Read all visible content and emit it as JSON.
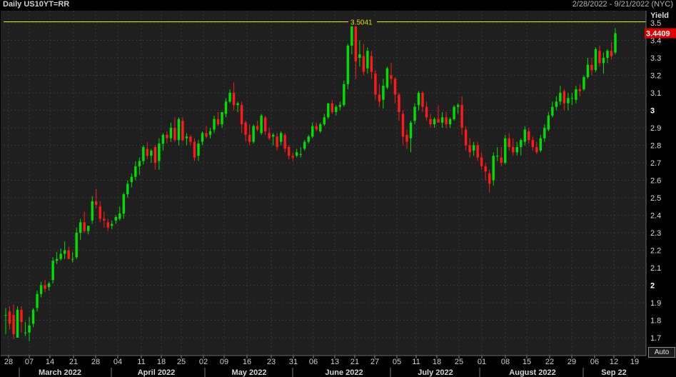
{
  "header": {
    "title": "Daily US10YT=RR",
    "date_range": "2/28/2022 - 9/21/2022 (NYC)",
    "y_axis_label": "Yield",
    "auto_button": "Auto"
  },
  "colors": {
    "up": "#00e000",
    "down": "#ff1a1a",
    "highlight": "#e8e800",
    "last_price_bg": "#e00000",
    "background": "#1e1f1e",
    "grid": "#3a3a3a"
  },
  "chart_data": {
    "type": "candlestick",
    "title": "Daily US10YT=RR",
    "ylabel": "Yield",
    "ylim": [
      1.64,
      3.55
    ],
    "y_ticks": [
      "1.7",
      "1.8",
      "1.9",
      "2",
      "2.1",
      "2.2",
      "2.3",
      "2.4",
      "2.5",
      "2.6",
      "2.7",
      "2.8",
      "2.9",
      "3",
      "3.1",
      "3.2",
      "3.3",
      "3.4",
      "3.5"
    ],
    "y_bold_ticks": [
      "2",
      "3"
    ],
    "x_day_ticks": [
      "28",
      "07",
      "14",
      "21",
      "28",
      "04",
      "11",
      "18",
      "25",
      "02",
      "09",
      "16",
      "23",
      "31",
      "06",
      "13",
      "21",
      "27",
      "05",
      "11",
      "18",
      "25",
      "01",
      "08",
      "15",
      "22",
      "29",
      "06",
      "12",
      "19"
    ],
    "x_month_labels": [
      "March 2022",
      "April 2022",
      "May 2022",
      "June 2022",
      "July 2022",
      "August 2022",
      "Sep 22"
    ],
    "highlight": {
      "label": "3.5041",
      "value": 3.5041
    },
    "last_price": {
      "label": "3.4409",
      "value": 3.4409
    },
    "grid": true,
    "candles": [
      {
        "o": 1.83,
        "h": 1.87,
        "l": 1.72,
        "c": 1.83
      },
      {
        "o": 1.85,
        "h": 1.88,
        "l": 1.75,
        "c": 1.78
      },
      {
        "o": 1.83,
        "h": 1.89,
        "l": 1.69,
        "c": 1.72
      },
      {
        "o": 1.7,
        "h": 1.88,
        "l": 1.7,
        "c": 1.86
      },
      {
        "o": 1.86,
        "h": 1.88,
        "l": 1.73,
        "c": 1.79
      },
      {
        "o": 1.73,
        "h": 1.79,
        "l": 1.71,
        "c": 1.73
      },
      {
        "o": 1.73,
        "h": 1.82,
        "l": 1.68,
        "c": 1.77
      },
      {
        "o": 1.78,
        "h": 1.87,
        "l": 1.76,
        "c": 1.86
      },
      {
        "o": 1.87,
        "h": 1.97,
        "l": 1.85,
        "c": 1.95
      },
      {
        "o": 1.95,
        "h": 2.02,
        "l": 1.93,
        "c": 2.0
      },
      {
        "o": 2.0,
        "h": 2.03,
        "l": 1.96,
        "c": 1.98
      },
      {
        "o": 1.99,
        "h": 2.02,
        "l": 1.97,
        "c": 2.01
      },
      {
        "o": 2.03,
        "h": 2.16,
        "l": 2.01,
        "c": 2.14
      },
      {
        "o": 2.14,
        "h": 2.19,
        "l": 2.12,
        "c": 2.15
      },
      {
        "o": 2.15,
        "h": 2.21,
        "l": 2.14,
        "c": 2.18
      },
      {
        "o": 2.18,
        "h": 2.25,
        "l": 2.15,
        "c": 2.2
      },
      {
        "o": 2.2,
        "h": 2.22,
        "l": 2.15,
        "c": 2.15
      },
      {
        "o": 2.15,
        "h": 2.19,
        "l": 2.13,
        "c": 2.15
      },
      {
        "o": 2.16,
        "h": 2.33,
        "l": 2.15,
        "c": 2.3
      },
      {
        "o": 2.3,
        "h": 2.38,
        "l": 2.26,
        "c": 2.36
      },
      {
        "o": 2.36,
        "h": 2.42,
        "l": 2.3,
        "c": 2.31
      },
      {
        "o": 2.31,
        "h": 2.34,
        "l": 2.29,
        "c": 2.34
      },
      {
        "o": 2.37,
        "h": 2.51,
        "l": 2.35,
        "c": 2.48
      },
      {
        "o": 2.48,
        "h": 2.55,
        "l": 2.44,
        "c": 2.46
      },
      {
        "o": 2.45,
        "h": 2.48,
        "l": 2.36,
        "c": 2.38
      },
      {
        "o": 2.38,
        "h": 2.42,
        "l": 2.33,
        "c": 2.37
      },
      {
        "o": 2.36,
        "h": 2.38,
        "l": 2.31,
        "c": 2.33
      },
      {
        "o": 2.34,
        "h": 2.37,
        "l": 2.32,
        "c": 2.35
      },
      {
        "o": 2.37,
        "h": 2.4,
        "l": 2.35,
        "c": 2.39
      },
      {
        "o": 2.38,
        "h": 2.45,
        "l": 2.37,
        "c": 2.41
      },
      {
        "o": 2.41,
        "h": 2.53,
        "l": 2.38,
        "c": 2.52
      },
      {
        "o": 2.52,
        "h": 2.6,
        "l": 2.5,
        "c": 2.58
      },
      {
        "o": 2.59,
        "h": 2.64,
        "l": 2.56,
        "c": 2.62
      },
      {
        "o": 2.62,
        "h": 2.71,
        "l": 2.6,
        "c": 2.68
      },
      {
        "o": 2.68,
        "h": 2.73,
        "l": 2.63,
        "c": 2.71
      },
      {
        "o": 2.71,
        "h": 2.8,
        "l": 2.69,
        "c": 2.79
      },
      {
        "o": 2.78,
        "h": 2.82,
        "l": 2.72,
        "c": 2.74
      },
      {
        "o": 2.74,
        "h": 2.78,
        "l": 2.7,
        "c": 2.77
      },
      {
        "o": 2.79,
        "h": 2.8,
        "l": 2.66,
        "c": 2.7
      },
      {
        "o": 2.71,
        "h": 2.84,
        "l": 2.66,
        "c": 2.81
      },
      {
        "o": 2.81,
        "h": 2.87,
        "l": 2.77,
        "c": 2.86
      },
      {
        "o": 2.86,
        "h": 2.88,
        "l": 2.81,
        "c": 2.84
      },
      {
        "o": 2.84,
        "h": 2.93,
        "l": 2.82,
        "c": 2.9
      },
      {
        "o": 2.9,
        "h": 2.96,
        "l": 2.82,
        "c": 2.83
      },
      {
        "o": 2.83,
        "h": 2.96,
        "l": 2.8,
        "c": 2.95
      },
      {
        "o": 2.94,
        "h": 2.96,
        "l": 2.82,
        "c": 2.83
      },
      {
        "o": 2.84,
        "h": 2.87,
        "l": 2.8,
        "c": 2.85
      },
      {
        "o": 2.85,
        "h": 2.86,
        "l": 2.8,
        "c": 2.82
      },
      {
        "o": 2.82,
        "h": 2.84,
        "l": 2.71,
        "c": 2.73
      },
      {
        "o": 2.74,
        "h": 2.83,
        "l": 2.71,
        "c": 2.81
      },
      {
        "o": 2.82,
        "h": 2.88,
        "l": 2.8,
        "c": 2.87
      },
      {
        "o": 2.87,
        "h": 2.91,
        "l": 2.84,
        "c": 2.85
      },
      {
        "o": 2.86,
        "h": 2.9,
        "l": 2.84,
        "c": 2.88
      },
      {
        "o": 2.89,
        "h": 2.97,
        "l": 2.87,
        "c": 2.95
      },
      {
        "o": 2.95,
        "h": 2.99,
        "l": 2.91,
        "c": 2.92
      },
      {
        "o": 2.92,
        "h": 2.99,
        "l": 2.9,
        "c": 2.99
      },
      {
        "o": 2.98,
        "h": 3.07,
        "l": 2.96,
        "c": 3.05
      },
      {
        "o": 3.05,
        "h": 3.12,
        "l": 3.04,
        "c": 3.1
      },
      {
        "o": 3.1,
        "h": 3.16,
        "l": 3.0,
        "c": 3.03
      },
      {
        "o": 3.03,
        "h": 3.05,
        "l": 2.99,
        "c": 3.04
      },
      {
        "o": 3.03,
        "h": 3.05,
        "l": 2.87,
        "c": 2.92
      },
      {
        "o": 2.93,
        "h": 2.94,
        "l": 2.82,
        "c": 2.86
      },
      {
        "o": 2.86,
        "h": 2.92,
        "l": 2.8,
        "c": 2.82
      },
      {
        "o": 2.82,
        "h": 2.92,
        "l": 2.81,
        "c": 2.91
      },
      {
        "o": 2.91,
        "h": 2.94,
        "l": 2.88,
        "c": 2.89
      },
      {
        "o": 2.87,
        "h": 2.98,
        "l": 2.86,
        "c": 2.97
      },
      {
        "o": 2.96,
        "h": 2.97,
        "l": 2.86,
        "c": 2.88
      },
      {
        "o": 2.87,
        "h": 2.9,
        "l": 2.83,
        "c": 2.84
      },
      {
        "o": 2.85,
        "h": 2.87,
        "l": 2.8,
        "c": 2.86
      },
      {
        "o": 2.85,
        "h": 2.87,
        "l": 2.77,
        "c": 2.79
      },
      {
        "o": 2.82,
        "h": 2.88,
        "l": 2.8,
        "c": 2.87
      },
      {
        "o": 2.86,
        "h": 2.87,
        "l": 2.76,
        "c": 2.78
      },
      {
        "o": 2.79,
        "h": 2.8,
        "l": 2.72,
        "c": 2.74
      },
      {
        "o": 2.74,
        "h": 2.76,
        "l": 2.71,
        "c": 2.73
      },
      {
        "o": 2.74,
        "h": 2.78,
        "l": 2.73,
        "c": 2.76
      },
      {
        "o": 2.75,
        "h": 2.79,
        "l": 2.73,
        "c": 2.75
      },
      {
        "o": 2.78,
        "h": 2.83,
        "l": 2.77,
        "c": 2.82
      },
      {
        "o": 2.82,
        "h": 2.86,
        "l": 2.81,
        "c": 2.85
      },
      {
        "o": 2.85,
        "h": 2.93,
        "l": 2.84,
        "c": 2.91
      },
      {
        "o": 2.91,
        "h": 2.93,
        "l": 2.88,
        "c": 2.89
      },
      {
        "o": 2.88,
        "h": 2.93,
        "l": 2.87,
        "c": 2.92
      },
      {
        "o": 2.92,
        "h": 2.98,
        "l": 2.91,
        "c": 2.96
      },
      {
        "o": 2.96,
        "h": 3.04,
        "l": 2.95,
        "c": 3.04
      },
      {
        "o": 3.04,
        "h": 3.06,
        "l": 2.98,
        "c": 2.99
      },
      {
        "o": 2.99,
        "h": 3.03,
        "l": 2.97,
        "c": 3.02
      },
      {
        "o": 3.02,
        "h": 3.05,
        "l": 3.0,
        "c": 3.03
      },
      {
        "o": 3.03,
        "h": 3.17,
        "l": 3.02,
        "c": 3.15
      },
      {
        "o": 3.15,
        "h": 3.38,
        "l": 3.12,
        "c": 3.37
      },
      {
        "o": 3.37,
        "h": 3.5,
        "l": 3.32,
        "c": 3.48
      },
      {
        "o": 3.48,
        "h": 3.49,
        "l": 3.18,
        "c": 3.28
      },
      {
        "o": 3.3,
        "h": 3.4,
        "l": 3.25,
        "c": 3.32
      },
      {
        "o": 3.31,
        "h": 3.38,
        "l": 3.2,
        "c": 3.22
      },
      {
        "o": 3.24,
        "h": 3.36,
        "l": 3.21,
        "c": 3.34
      },
      {
        "o": 3.31,
        "h": 3.34,
        "l": 3.18,
        "c": 3.22
      },
      {
        "o": 3.21,
        "h": 3.23,
        "l": 3.06,
        "c": 3.09
      },
      {
        "o": 3.09,
        "h": 3.15,
        "l": 3.02,
        "c": 3.05
      },
      {
        "o": 3.06,
        "h": 3.18,
        "l": 3.01,
        "c": 3.14
      },
      {
        "o": 3.13,
        "h": 3.25,
        "l": 3.12,
        "c": 3.24
      },
      {
        "o": 3.2,
        "h": 3.27,
        "l": 3.15,
        "c": 3.18
      },
      {
        "o": 3.18,
        "h": 3.19,
        "l": 3.04,
        "c": 3.09
      },
      {
        "o": 3.09,
        "h": 3.1,
        "l": 2.94,
        "c": 2.99
      },
      {
        "o": 2.98,
        "h": 3.0,
        "l": 2.8,
        "c": 2.85
      },
      {
        "o": 2.86,
        "h": 2.89,
        "l": 2.78,
        "c": 2.82
      },
      {
        "o": 2.84,
        "h": 2.94,
        "l": 2.76,
        "c": 2.93
      },
      {
        "o": 2.94,
        "h": 3.04,
        "l": 2.92,
        "c": 3.02
      },
      {
        "o": 3.03,
        "h": 3.11,
        "l": 3.0,
        "c": 3.1
      },
      {
        "o": 3.1,
        "h": 3.11,
        "l": 2.99,
        "c": 3.02
      },
      {
        "o": 3.02,
        "h": 3.05,
        "l": 2.94,
        "c": 2.96
      },
      {
        "o": 2.95,
        "h": 2.98,
        "l": 2.9,
        "c": 2.92
      },
      {
        "o": 2.92,
        "h": 2.96,
        "l": 2.9,
        "c": 2.95
      },
      {
        "o": 2.95,
        "h": 3.03,
        "l": 2.93,
        "c": 2.93
      },
      {
        "o": 2.93,
        "h": 2.99,
        "l": 2.9,
        "c": 2.96
      },
      {
        "o": 2.96,
        "h": 2.99,
        "l": 2.9,
        "c": 2.92
      },
      {
        "o": 2.92,
        "h": 2.96,
        "l": 2.9,
        "c": 2.95
      },
      {
        "o": 2.95,
        "h": 3.03,
        "l": 2.94,
        "c": 3.02
      },
      {
        "o": 3.02,
        "h": 3.04,
        "l": 2.98,
        "c": 3.03
      },
      {
        "o": 3.03,
        "h": 3.08,
        "l": 2.86,
        "c": 2.9
      },
      {
        "o": 2.89,
        "h": 2.91,
        "l": 2.77,
        "c": 2.8
      },
      {
        "o": 2.8,
        "h": 2.84,
        "l": 2.73,
        "c": 2.76
      },
      {
        "o": 2.77,
        "h": 2.82,
        "l": 2.74,
        "c": 2.8
      },
      {
        "o": 2.8,
        "h": 2.82,
        "l": 2.71,
        "c": 2.73
      },
      {
        "o": 2.73,
        "h": 2.76,
        "l": 2.66,
        "c": 2.68
      },
      {
        "o": 2.68,
        "h": 2.7,
        "l": 2.6,
        "c": 2.65
      },
      {
        "o": 2.64,
        "h": 2.66,
        "l": 2.53,
        "c": 2.58
      },
      {
        "o": 2.6,
        "h": 2.76,
        "l": 2.57,
        "c": 2.74
      },
      {
        "o": 2.74,
        "h": 2.79,
        "l": 2.71,
        "c": 2.74
      },
      {
        "o": 2.73,
        "h": 2.79,
        "l": 2.68,
        "c": 2.7
      },
      {
        "o": 2.7,
        "h": 2.86,
        "l": 2.69,
        "c": 2.84
      },
      {
        "o": 2.84,
        "h": 2.87,
        "l": 2.77,
        "c": 2.79
      },
      {
        "o": 2.79,
        "h": 2.84,
        "l": 2.74,
        "c": 2.76
      },
      {
        "o": 2.76,
        "h": 2.82,
        "l": 2.74,
        "c": 2.79
      },
      {
        "o": 2.79,
        "h": 2.84,
        "l": 2.74,
        "c": 2.83
      },
      {
        "o": 2.82,
        "h": 2.91,
        "l": 2.8,
        "c": 2.89
      },
      {
        "o": 2.88,
        "h": 2.9,
        "l": 2.81,
        "c": 2.83
      },
      {
        "o": 2.83,
        "h": 2.85,
        "l": 2.77,
        "c": 2.79
      },
      {
        "o": 2.79,
        "h": 2.82,
        "l": 2.75,
        "c": 2.76
      },
      {
        "o": 2.77,
        "h": 2.86,
        "l": 2.76,
        "c": 2.84
      },
      {
        "o": 2.84,
        "h": 2.92,
        "l": 2.82,
        "c": 2.9
      },
      {
        "o": 2.89,
        "h": 2.99,
        "l": 2.88,
        "c": 2.97
      },
      {
        "o": 2.97,
        "h": 3.05,
        "l": 2.96,
        "c": 3.02
      },
      {
        "o": 3.02,
        "h": 3.08,
        "l": 3.0,
        "c": 3.05
      },
      {
        "o": 3.05,
        "h": 3.14,
        "l": 3.03,
        "c": 3.1
      },
      {
        "o": 3.11,
        "h": 3.12,
        "l": 3.0,
        "c": 3.04
      },
      {
        "o": 3.04,
        "h": 3.1,
        "l": 3.0,
        "c": 3.07
      },
      {
        "o": 3.07,
        "h": 3.1,
        "l": 3.03,
        "c": 3.07
      },
      {
        "o": 3.06,
        "h": 3.14,
        "l": 3.04,
        "c": 3.12
      },
      {
        "o": 3.12,
        "h": 3.15,
        "l": 3.08,
        "c": 3.11
      },
      {
        "o": 3.12,
        "h": 3.2,
        "l": 3.11,
        "c": 3.19
      },
      {
        "o": 3.19,
        "h": 3.3,
        "l": 3.18,
        "c": 3.26
      },
      {
        "o": 3.26,
        "h": 3.3,
        "l": 3.2,
        "c": 3.23
      },
      {
        "o": 3.23,
        "h": 3.36,
        "l": 3.22,
        "c": 3.35
      },
      {
        "o": 3.34,
        "h": 3.37,
        "l": 3.25,
        "c": 3.27
      },
      {
        "o": 3.27,
        "h": 3.33,
        "l": 3.21,
        "c": 3.3
      },
      {
        "o": 3.3,
        "h": 3.35,
        "l": 3.27,
        "c": 3.34
      },
      {
        "o": 3.34,
        "h": 3.39,
        "l": 3.29,
        "c": 3.31
      },
      {
        "o": 3.33,
        "h": 3.47,
        "l": 3.32,
        "c": 3.44
      }
    ]
  }
}
